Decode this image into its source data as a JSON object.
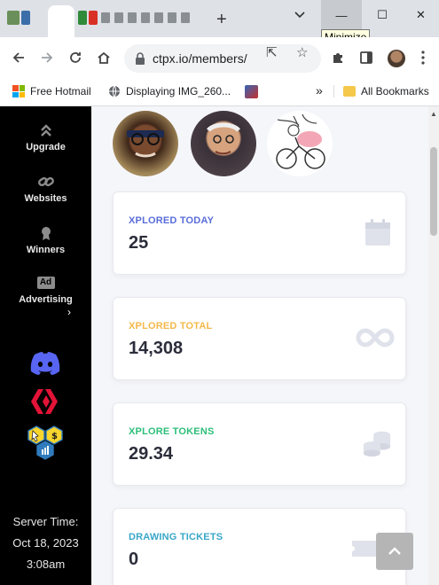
{
  "browser": {
    "tooltip": "Minimize",
    "new_tab": "+",
    "tab_close": "×",
    "url": "ctpx.io/members/",
    "window_minimize": "—",
    "window_maximize": "☐",
    "window_close": "✕"
  },
  "bookmarks": {
    "items": [
      {
        "label": "Free Hotmail"
      },
      {
        "label": "Displaying IMG_260..."
      },
      {
        "label": "All Bookmarks"
      }
    ],
    "overflow": "»"
  },
  "sidebar": {
    "items": [
      {
        "label": "Upgrade",
        "icon": "chevrons-up-icon"
      },
      {
        "label": "Websites",
        "icon": "link-icon"
      },
      {
        "label": "Winners",
        "icon": "medal-icon"
      },
      {
        "label": "Advertising",
        "icon": "ad-icon",
        "icon_text": "Ad"
      }
    ],
    "social": [
      "discord-icon",
      "hive-icon",
      "ctpx-token-icon"
    ],
    "server_time_label": "Server Time:",
    "server_date": "Oct 18, 2023",
    "server_clock": "3:08am"
  },
  "stats": [
    {
      "label": "XPLORED TODAY",
      "value": "25",
      "color": "#5a6dd8",
      "icon": "calendar-icon"
    },
    {
      "label": "XPLORED TOTAL",
      "value": "14,308",
      "color": "#f5b84b",
      "icon": "infinity-icon"
    },
    {
      "label": "XPLORE TOKENS",
      "value": "29.34",
      "color": "#2dbf7a",
      "icon": "coins-icon"
    },
    {
      "label": "DRAWING TICKETS",
      "value": "0",
      "color": "#39a7c9",
      "icon": "ticket-icon"
    }
  ],
  "colors": {
    "sidebar_bg": "#000000",
    "page_bg": "#f5f6fa",
    "discord": "#5865f2",
    "hive": "#e31337"
  }
}
